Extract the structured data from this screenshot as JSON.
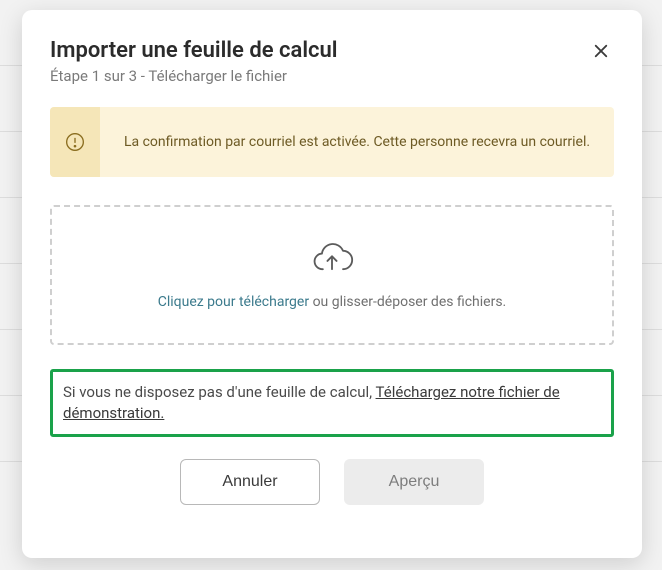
{
  "modal": {
    "title": "Importer une feuille de calcul",
    "subtitle": "Étape 1 sur 3 - Télécharger le fichier"
  },
  "alert": {
    "text": "La confirmation par courriel est activée. Cette personne recevra un courriel."
  },
  "dropzone": {
    "link_text": "Cliquez pour télécharger",
    "rest_text": " ou glisser-déposer des fichiers."
  },
  "help": {
    "prefix": "Si vous ne disposez pas d'une feuille de calcul, ",
    "link_text": "Téléchargez notre fichier de démonstration."
  },
  "buttons": {
    "cancel": "Annuler",
    "preview": "Aperçu"
  }
}
